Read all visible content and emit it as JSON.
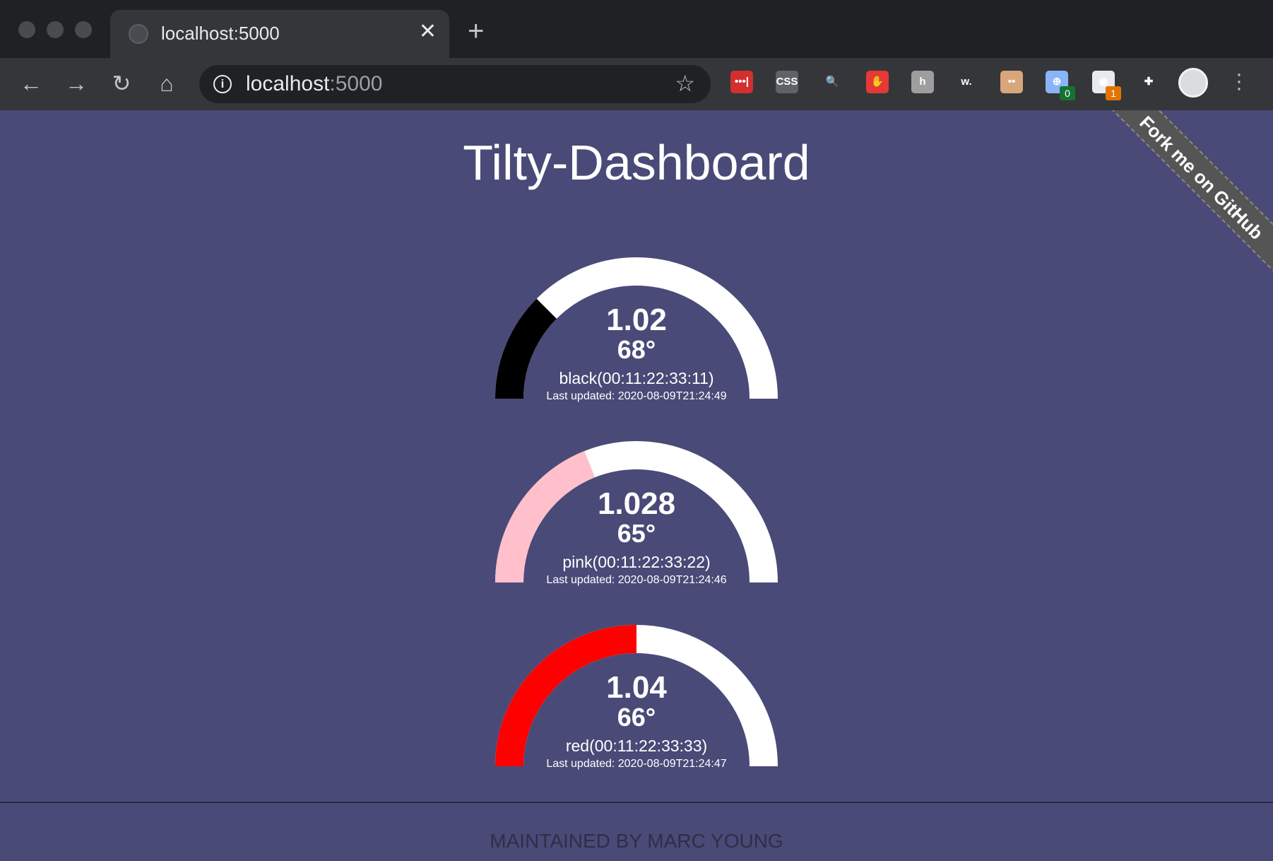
{
  "browser": {
    "tab_title": "localhost:5000",
    "close_glyph": "✕",
    "new_tab_glyph": "+",
    "url_host": "localhost",
    "url_port": ":5000",
    "extensions": [
      {
        "name": "lastpass-icon",
        "label": "•••|",
        "color": "#d32f2f"
      },
      {
        "name": "css-viewer-icon",
        "label": "CSS",
        "color": "#5f6368"
      },
      {
        "name": "inspector-icon",
        "label": "🔍",
        "color": "#35363a"
      },
      {
        "name": "adblock-icon",
        "label": "✋",
        "color": "#e53935"
      },
      {
        "name": "h-extension-icon",
        "label": "h",
        "color": "#9e9e9e"
      },
      {
        "name": "wordtune-icon",
        "label": "w.",
        "color": "#35363a"
      },
      {
        "name": "box-face-icon",
        "label": "••",
        "color": "#d7a77a"
      },
      {
        "name": "globe-extension-icon",
        "label": "⊕",
        "color": "#8ab4f8"
      },
      {
        "name": "privacy-badger-icon",
        "label": "◉",
        "color": "#e8eaed"
      },
      {
        "name": "extensions-puzzle-icon",
        "label": "✚",
        "color": "#35363a"
      }
    ],
    "badges": {
      "globe": "0",
      "badger": "1"
    }
  },
  "page": {
    "title": "Tilty-Dashboard",
    "ribbon": "Fork me on GitHub",
    "footer": "MAINTAINED BY MARC YOUNG"
  },
  "gauges": [
    {
      "gravity": "1.02",
      "temp": "68°",
      "name": "black(00:11:22:33:11)",
      "updated": "Last updated: 2020-08-09T21:24:49",
      "fill_fraction": 0.25,
      "color": "#000000"
    },
    {
      "gravity": "1.028",
      "temp": "65°",
      "name": "pink(00:11:22:33:22)",
      "updated": "Last updated: 2020-08-09T21:24:46",
      "fill_fraction": 0.38,
      "color": "#ffc0cb"
    },
    {
      "gravity": "1.04",
      "temp": "66°",
      "name": "red(00:11:22:33:33)",
      "updated": "Last updated: 2020-08-09T21:24:47",
      "fill_fraction": 0.5,
      "color": "#ff0000"
    }
  ]
}
